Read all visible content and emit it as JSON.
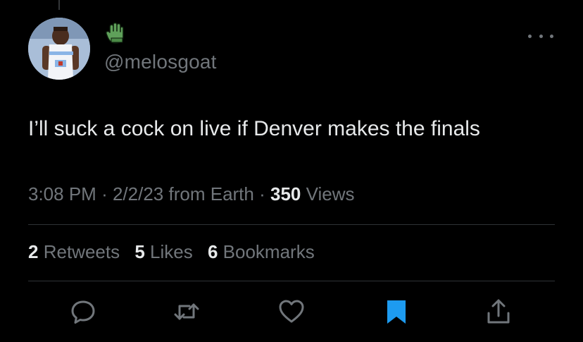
{
  "user": {
    "handle": "@melosgoat",
    "avatar": "avatar",
    "badge_icon": "green-glove-emoji",
    "badge_color": "#5fa05a"
  },
  "tweet": {
    "text": "I’ll suck a cock on live if Denver makes the finals",
    "time": "3:08 PM",
    "date": "2/2/23",
    "source": "from Earth",
    "views_count": "350",
    "views_label": "Views",
    "separator": "·"
  },
  "stats": {
    "retweets_count": "2",
    "retweets_label": "Retweets",
    "likes_count": "5",
    "likes_label": "Likes",
    "bookmarks_count": "6",
    "bookmarks_label": "Bookmarks"
  },
  "actions": [
    {
      "name": "reply-icon"
    },
    {
      "name": "retweet-icon"
    },
    {
      "name": "like-icon"
    },
    {
      "name": "bookmark-icon",
      "state": "active",
      "color": "#1d9bf0"
    },
    {
      "name": "share-icon"
    }
  ],
  "colors": {
    "background": "#000000",
    "text_primary": "#e7e9ea",
    "text_secondary": "#71767b",
    "divider": "#2f3336",
    "accent": "#1d9bf0"
  }
}
